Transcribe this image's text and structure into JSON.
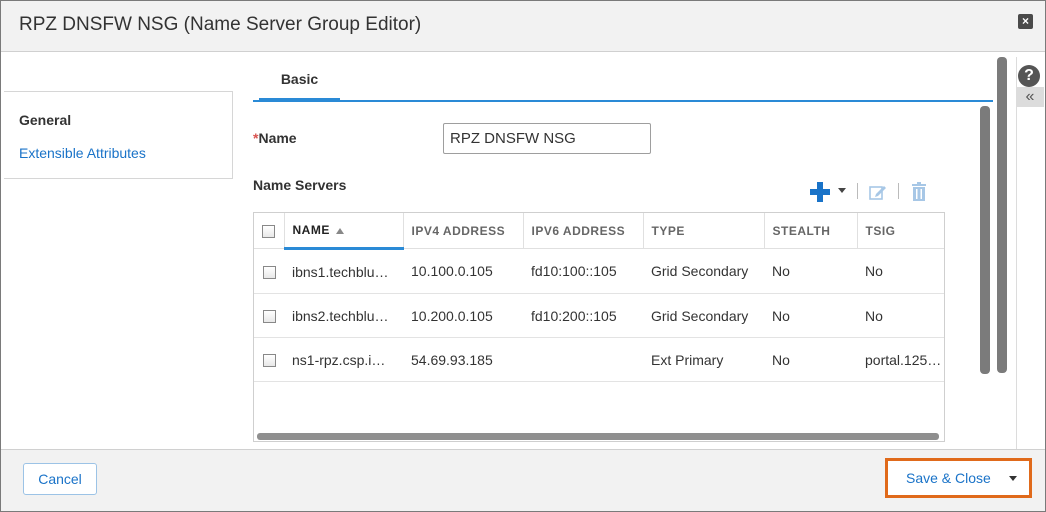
{
  "dialog": {
    "title": "RPZ DNSFW NSG (Name Server Group Editor)",
    "close_icon": "close-icon"
  },
  "sidebar": {
    "items": [
      {
        "label": "General"
      },
      {
        "label": "Extensible Attributes"
      }
    ]
  },
  "tabs": [
    {
      "label": "Basic"
    }
  ],
  "form": {
    "name_label": "Name",
    "required_mark": "*",
    "name_value": "RPZ DNSFW NSG",
    "name_servers_label": "Name Servers"
  },
  "toolbar_icons": [
    "plus-icon",
    "chevron-down-icon",
    "edit-icon",
    "trash-icon"
  ],
  "table": {
    "columns": [
      "NAME",
      "IPV4 ADDRESS",
      "IPV6 ADDRESS",
      "TYPE",
      "STEALTH",
      "TSIG"
    ],
    "rows": [
      [
        "ibns1.techblu…",
        "10.100.0.105",
        "fd10:100::105",
        "Grid Secondary",
        "No",
        "No"
      ],
      [
        "ibns2.techblu…",
        "10.200.0.105",
        "fd10:200::105",
        "Grid Secondary",
        "No",
        "No"
      ],
      [
        "ns1-rpz.csp.i…",
        "54.69.93.185",
        "",
        "Ext Primary",
        "No",
        "portal.125…"
      ]
    ]
  },
  "help": {
    "icon_text": "?",
    "collapse_text": "«"
  },
  "footer": {
    "cancel_label": "Cancel",
    "save_label": "Save & Close"
  },
  "colors": {
    "accent": "#2a8ad6",
    "link": "#1a73c8",
    "highlight": "#e06a1b"
  }
}
